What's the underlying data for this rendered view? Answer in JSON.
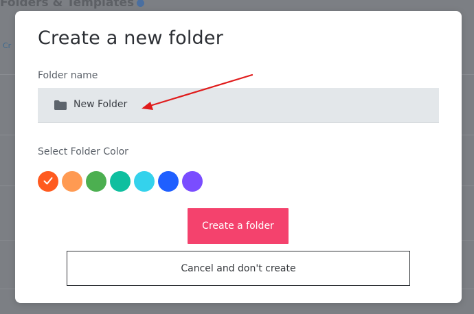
{
  "background": {
    "title": "Folders & Templates",
    "side_text": "Cr"
  },
  "modal": {
    "title": "Create a new folder",
    "folder_name_label": "Folder name",
    "folder_name_value": "New Folder",
    "folder_icon": "folder-icon",
    "color_label": "Select Folder Color",
    "colors": [
      {
        "name": "orange-red",
        "hex": "#ff5a1f",
        "selected": true
      },
      {
        "name": "light-orange",
        "hex": "#ff9a52",
        "selected": false
      },
      {
        "name": "green",
        "hex": "#4caf50",
        "selected": false
      },
      {
        "name": "teal",
        "hex": "#0fbf9f",
        "selected": false
      },
      {
        "name": "cyan",
        "hex": "#34d2ec",
        "selected": false
      },
      {
        "name": "blue",
        "hex": "#1f5fff",
        "selected": false
      },
      {
        "name": "purple",
        "hex": "#7a4dff",
        "selected": false
      }
    ],
    "create_label": "Create a folder",
    "cancel_label": "Cancel and don't create",
    "accent_color": "#f4426d",
    "annotation_color": "#e01b1b"
  }
}
